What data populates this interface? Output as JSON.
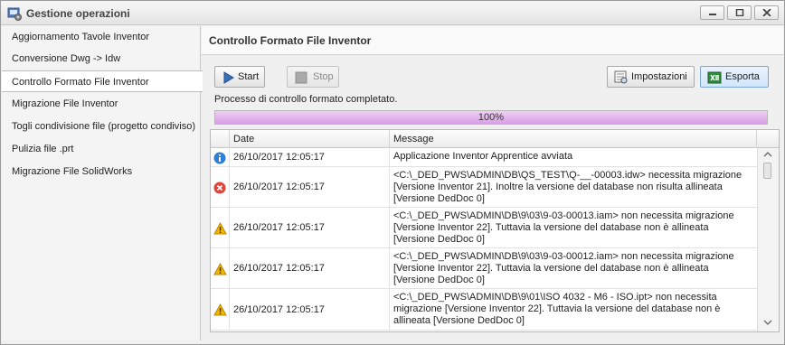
{
  "window": {
    "title": "Gestione operazioni"
  },
  "sidebar": {
    "items": [
      {
        "label": "Aggiornamento Tavole Inventor"
      },
      {
        "label": "Conversione Dwg -> Idw"
      },
      {
        "label": "Controllo Formato File Inventor",
        "active": true
      },
      {
        "label": "Migrazione File Inventor"
      },
      {
        "label": "Togli condivisione file (progetto condiviso)"
      },
      {
        "label": "Pulizia file .prt"
      },
      {
        "label": "Migrazione File SolidWorks"
      }
    ]
  },
  "main": {
    "title": "Controllo Formato File Inventor",
    "toolbar": {
      "start_label": "Start",
      "stop_label": "Stop",
      "settings_label": "Impostazioni",
      "export_label": "Esporta"
    },
    "status": "Processo di controllo formato completato.",
    "progress": {
      "percent": 100,
      "text": "100%"
    },
    "log": {
      "columns": [
        "Date",
        "Message"
      ],
      "rows": [
        {
          "level": "info",
          "date": "26/10/2017 12:05:17",
          "message": "Applicazione Inventor Apprentice avviata"
        },
        {
          "level": "error",
          "date": "26/10/2017 12:05:17",
          "message": "<C:\\_DED_PWS\\ADMIN\\DB\\QS_TEST\\Q-__-00003.idw> necessita migrazione [Versione Inventor 21]. Inoltre la versione del database non risulta allineata [Versione DedDoc 0]"
        },
        {
          "level": "warning",
          "date": "26/10/2017 12:05:17",
          "message": "<C:\\_DED_PWS\\ADMIN\\DB\\9\\03\\9-03-00013.iam> non necessita migrazione [Versione Inventor 22]. Tuttavia la versione del database non è allineata [Versione DedDoc 0]"
        },
        {
          "level": "warning",
          "date": "26/10/2017 12:05:17",
          "message": "<C:\\_DED_PWS\\ADMIN\\DB\\9\\03\\9-03-00012.iam> non necessita migrazione [Versione Inventor 22]. Tuttavia la versione del database non è allineata [Versione DedDoc 0]"
        },
        {
          "level": "warning",
          "date": "26/10/2017 12:05:17",
          "message": "<C:\\_DED_PWS\\ADMIN\\DB\\9\\01\\ISO 4032 - M6 - ISO.ipt> non necessita migrazione [Versione Inventor 22]. Tuttavia la versione del database non è allineata [Versione DedDoc 0]"
        }
      ]
    }
  },
  "colors": {
    "progress_fill": "#d79ee5",
    "info": "#2f7fd8",
    "error": "#e0453a",
    "warning": "#f2b600"
  }
}
